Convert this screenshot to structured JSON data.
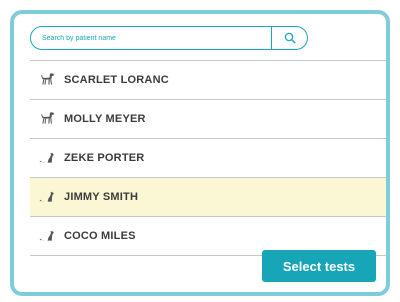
{
  "search": {
    "placeholder": "Search by patient name",
    "icon": "search-icon"
  },
  "patients": [
    {
      "name": "SCARLET LORANC",
      "species_icon": "dog-icon",
      "selected": false
    },
    {
      "name": "MOLLY MEYER",
      "species_icon": "dog-icon",
      "selected": false
    },
    {
      "name": "ZEKE PORTER",
      "species_icon": "cat-icon",
      "selected": false
    },
    {
      "name": "JIMMY SMITH",
      "species_icon": "cat-icon",
      "selected": true
    },
    {
      "name": "COCO MILES",
      "species_icon": "cat-icon",
      "selected": false
    }
  ],
  "footer": {
    "select_label": "Select tests"
  },
  "colors": {
    "accent": "#17a6b7",
    "frame_border": "#7fcdd9",
    "selected_row": "#fbf6d4",
    "icon": "#555555"
  }
}
